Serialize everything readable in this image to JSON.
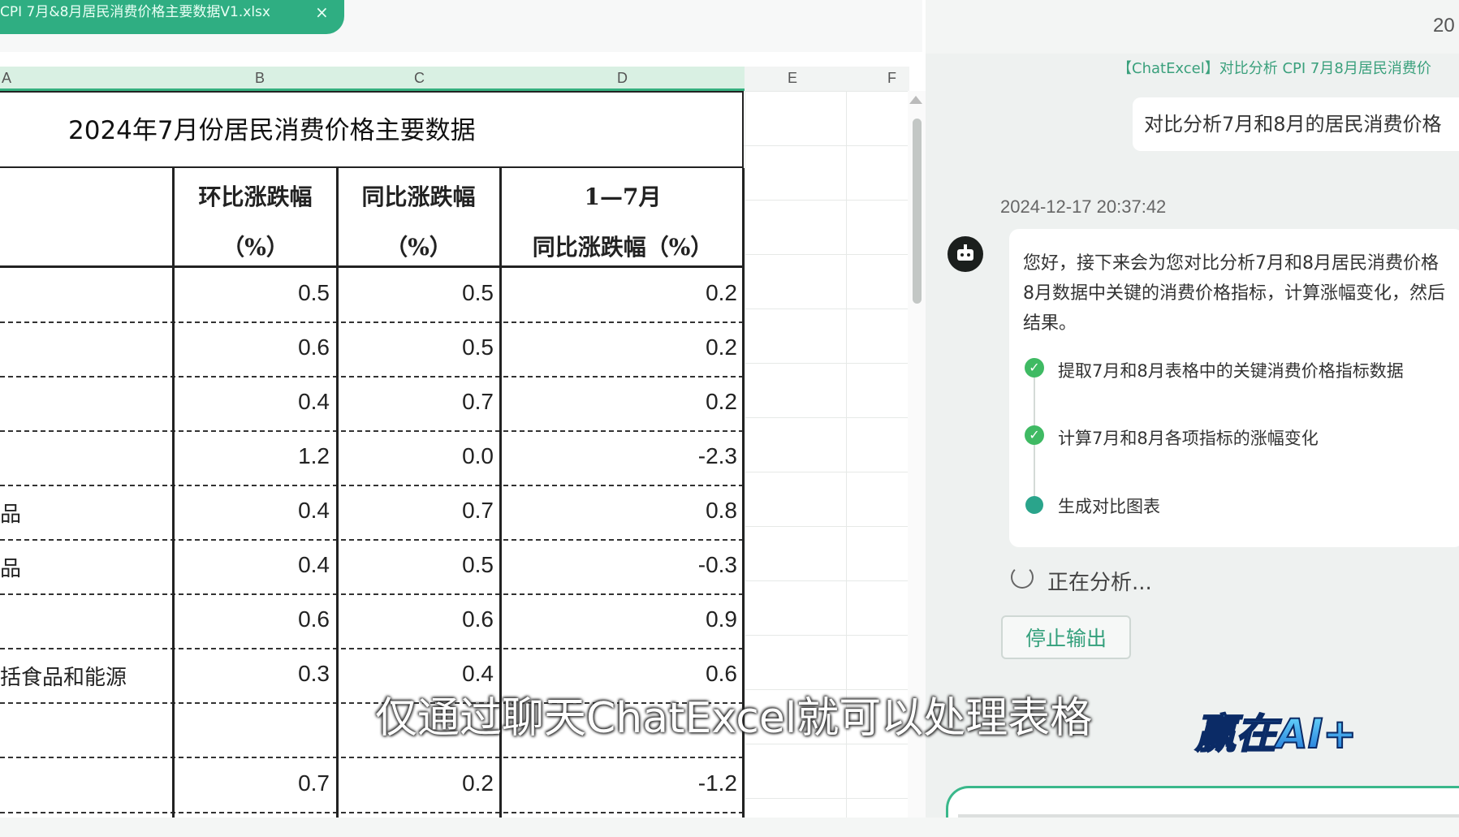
{
  "tab": {
    "filename": "CPI 7月&8月居民消费价格主要数据V1.xlsx",
    "close": "×"
  },
  "columns": [
    "A",
    "B",
    "C",
    "D",
    "E",
    "F"
  ],
  "sheet": {
    "title": "2024年7月份居民消费价格主要数据",
    "headers": [
      {
        "line1": "环比涨跌幅",
        "line2": "（%）"
      },
      {
        "line1": "同比涨跌幅",
        "line2": "（%）"
      },
      {
        "line1": "1—7月",
        "line2": "同比涨跌幅（%）"
      }
    ],
    "rows": [
      {
        "label": "",
        "b": "0.5",
        "c": "0.5",
        "d": "0.2"
      },
      {
        "label": "",
        "b": "0.6",
        "c": "0.5",
        "d": "0.2"
      },
      {
        "label": "",
        "b": "0.4",
        "c": "0.7",
        "d": "0.2"
      },
      {
        "label": "",
        "b": "1.2",
        "c": "0.0",
        "d": "-2.3"
      },
      {
        "label": "品",
        "b": "0.4",
        "c": "0.7",
        "d": "0.8"
      },
      {
        "label": "品",
        "b": "0.4",
        "c": "0.5",
        "d": "-0.3"
      },
      {
        "label": "",
        "b": "0.6",
        "c": "0.6",
        "d": "0.9"
      },
      {
        "label": "括食品和能源",
        "b": "0.3",
        "c": "0.4",
        "d": "0.6"
      },
      {
        "label": "",
        "b": "",
        "c": "",
        "d": ""
      },
      {
        "label": "",
        "b": "0.7",
        "c": "0.2",
        "d": "-1.2"
      }
    ]
  },
  "chat": {
    "top_right": "20",
    "tag": "【ChatExcel】对比分析 CPI 7月8月居民消费价",
    "user_message": "对比分析7月和8月的居民消费价格",
    "timestamp": "2024-12-17 20:37:42",
    "bot_lines": [
      "您好，接下来会为您对比分析7月和8月居民消费价格",
      "8月数据中关键的消费价格指标，计算涨幅变化，然后",
      "结果。"
    ],
    "steps": [
      {
        "text": "提取7月和8月表格中的关键消费价格指标数据",
        "status": "done"
      },
      {
        "text": "计算7月和8月各项指标的涨幅变化",
        "status": "done"
      },
      {
        "text": "生成对比图表",
        "status": "in-progress"
      }
    ],
    "analyzing": "正在分析...",
    "stop_button": "停止输出"
  },
  "overlay": {
    "subtitle": "仅通过聊天ChatExcel就可以处理表格",
    "logo_text": "赢在AI+"
  },
  "colors": {
    "accent": "#2fae82",
    "header_green": "#d9f0e3",
    "check_green": "#3fba63"
  }
}
